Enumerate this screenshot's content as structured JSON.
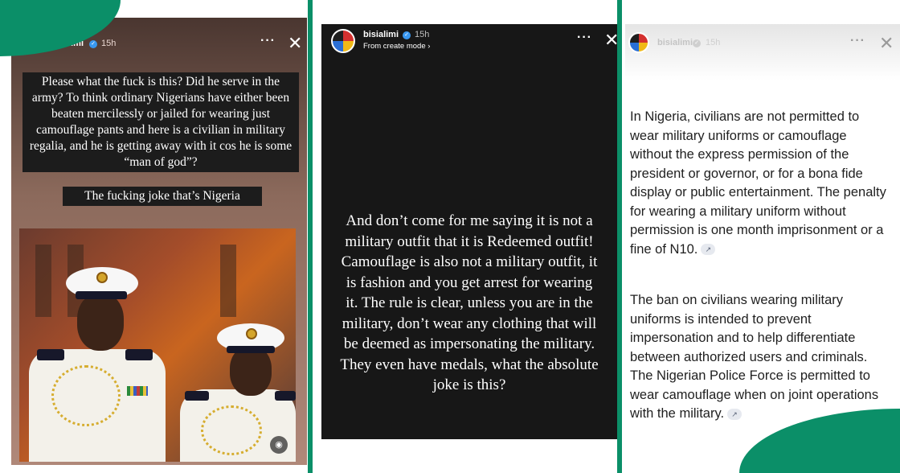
{
  "stories": [
    {
      "username": "bisialimi",
      "time": "15h",
      "caption_main": "Please what the fuck is this? Did he serve in the army? To think ordinary Nigerians have either been beaten mercilessly or jailed for wearing just camouflage pants and here is a civilian in military regalia, and he is getting away with it cos he is some “man of god”?",
      "caption_secondary": "The fucking joke that’s Nigeria"
    },
    {
      "username": "bisialimi",
      "time": "15h",
      "subtitle": "From create mode",
      "body": "And don’t come for me saying it is not a military outfit that it is Redeemed outfit! Camouflage is also not a military outfit, it is fashion and you get arrest for wearing it. The rule is clear, unless you are in the military, don’t wear any clothing that will be deemed as impersonating the military. They even have medals, what the absolute joke is this?"
    },
    {
      "username": "bisialimi",
      "time": "15h",
      "paragraph_1": "In Nigeria, civilians are not permitted to wear military uniforms or camouflage without the express permission of the president or governor, or for a bona fide display or public entertainment. The penalty for wearing a military uniform without permission is one month imprisonment or a fine of N10.",
      "paragraph_2": "The ban on civilians wearing military uniforms is intended to prevent impersonation and to help differentiate between authorized users and criminals. The Nigerian Police Force is permitted to wear camouflage when on joint operations with the military."
    }
  ],
  "icons": {
    "more": "···",
    "close": "✕",
    "verified": "✓",
    "chevron": "›",
    "link": "↗",
    "mute": "◉"
  },
  "colors": {
    "accent": "#0b8f68",
    "verified": "#3897f0"
  }
}
